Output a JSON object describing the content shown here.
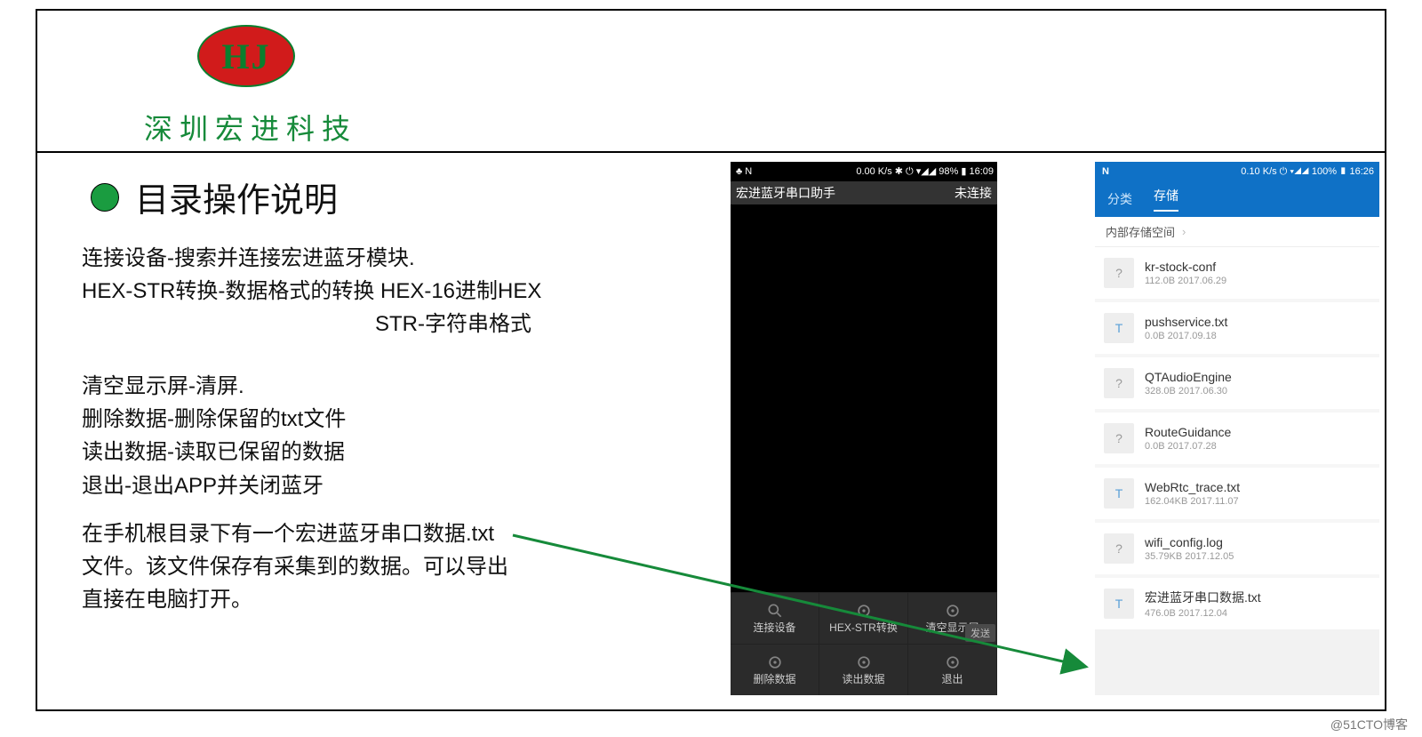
{
  "header": {
    "logo_letters": "HJ",
    "company": "深圳宏进科技"
  },
  "content": {
    "title": "目录操作说明",
    "lines1": [
      "连接设备-搜索并连接宏进蓝牙模块.",
      "HEX-STR转换-数据格式的转换 HEX-16进制HEX"
    ],
    "line1_indent": "STR-字符串格式",
    "lines2": [
      "清空显示屏-清屏.",
      "删除数据-删除保留的txt文件",
      "读出数据-读取已保留的数据",
      "退出-退出APP并关闭蓝牙"
    ],
    "lines3": [
      "在手机根目录下有一个宏进蓝牙串口数据.txt",
      "文件。该文件保存有采集到的数据。可以导出",
      "直接在电脑打开。"
    ]
  },
  "phone1": {
    "status_left": "♣ N",
    "status_right": "0.00 K/s ✱ ⏻ ▾◢◢ 98% ▮ 16:09",
    "app_title": "宏进蓝牙串口助手",
    "app_status": "未连接",
    "menu": [
      "连接设备",
      "HEX-STR转换",
      "清空显示屏",
      "删除数据",
      "读出数据",
      "退出"
    ],
    "send": "发送"
  },
  "phone2": {
    "status_leftN": "N",
    "status_right": "0.10 K/s ⏻ ▾◢◢ 100% ▮ 16:26",
    "tab1": "分类",
    "tab2": "存储",
    "path": "内部存储空间",
    "path_chevron": "›",
    "files": [
      {
        "icon": "?",
        "name": "kr-stock-conf",
        "sub": "112.0B  2017.06.29"
      },
      {
        "icon": "T",
        "name": "pushservice.txt",
        "sub": "0.0B  2017.09.18"
      },
      {
        "icon": "?",
        "name": "QTAudioEngine",
        "sub": "328.0B  2017.06.30"
      },
      {
        "icon": "?",
        "name": "RouteGuidance",
        "sub": "0.0B  2017.07.28"
      },
      {
        "icon": "T",
        "name": "WebRtc_trace.txt",
        "sub": "162.04KB  2017.11.07"
      },
      {
        "icon": "?",
        "name": "wifi_config.log",
        "sub": "35.79KB  2017.12.05"
      },
      {
        "icon": "T",
        "name": "宏进蓝牙串口数据.txt",
        "sub": "476.0B  2017.12.04"
      }
    ]
  },
  "watermark": "@51CTO博客"
}
